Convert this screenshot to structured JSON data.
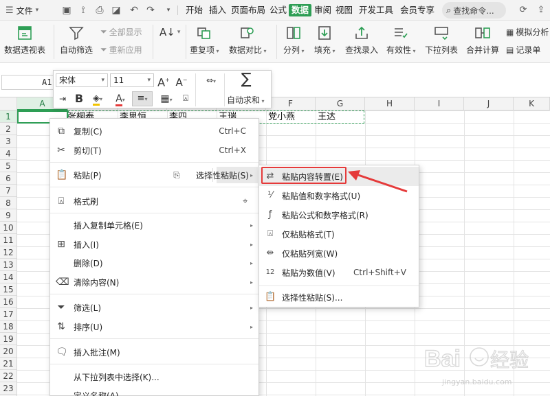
{
  "menubar": {
    "file": "文件",
    "tabs": [
      "开始",
      "插入",
      "页面布局",
      "公式",
      "数据",
      "审阅",
      "视图",
      "开发工具",
      "会员专享"
    ],
    "active_tab": "数据",
    "search_placeholder": "查找命令..."
  },
  "ribbon": {
    "pivot": "数据透视表",
    "autofilter": "自动筛选",
    "show_all": "全部显示",
    "reapply": "重新应用",
    "sort_icon": "AZ-sort-icon",
    "dup": "重复项",
    "compare": "数据对比",
    "split": "分列",
    "fill": "填充",
    "lookup": "查找录入",
    "validity": "有效性",
    "dropdown": "下拉列表",
    "consolidate": "合并计算",
    "simulate": "模拟分析",
    "record": "记录单"
  },
  "namebox": {
    "value": "A1"
  },
  "minibar": {
    "font": "宋体",
    "size": "11",
    "autosum": "自动求和",
    "bold": "B",
    "grow": "A",
    "shrink": "A"
  },
  "columns": [
    "A",
    "B",
    "C",
    "D",
    "E",
    "F",
    "G",
    "H",
    "I",
    "J",
    "K"
  ],
  "rows": [
    "1",
    "2",
    "3",
    "4",
    "5",
    "6",
    "7",
    "8",
    "9",
    "10",
    "11",
    "12",
    "13",
    "14",
    "15",
    "16",
    "17",
    "18",
    "19",
    "20",
    "21",
    "22",
    "23"
  ],
  "cells_row1": [
    "张桐泰",
    "李思恒",
    "李四",
    "王瑞",
    "党小燕",
    "王达"
  ],
  "context_menu": {
    "copy": {
      "label": "复制(C)",
      "key": "Ctrl+C"
    },
    "cut": {
      "label": "剪切(T)",
      "key": "Ctrl+X"
    },
    "paste": {
      "label": "粘贴(P)"
    },
    "paste_special": {
      "label": "选择性粘贴(S)"
    },
    "format_painter": {
      "label": "格式刷"
    },
    "insert_copied": {
      "label": "插入复制单元格(E)"
    },
    "insert": {
      "label": "插入(I)"
    },
    "delete": {
      "label": "删除(D)"
    },
    "clear": {
      "label": "清除内容(N)"
    },
    "filter": {
      "label": "筛选(L)"
    },
    "sort": {
      "label": "排序(U)"
    },
    "comment": {
      "label": "插入批注(M)"
    },
    "pick_list": {
      "label": "从下拉列表中选择(K)..."
    },
    "define_name": {
      "label": "定义名称(A)..."
    }
  },
  "submenu": {
    "transpose": {
      "label": "粘贴内容转置(E)"
    },
    "values_numfmt": {
      "label": "粘贴值和数字格式(U)"
    },
    "formulas_numfmt": {
      "label": "粘贴公式和数字格式(R)"
    },
    "formats_only": {
      "label": "仅粘贴格式(T)"
    },
    "col_widths": {
      "label": "仅粘贴列宽(W)"
    },
    "as_values": {
      "label": "粘贴为数值(V)",
      "key": "Ctrl+Shift+V"
    },
    "paste_special": {
      "label": "选择性粘贴(S)..."
    }
  },
  "watermark": {
    "brand": "Bai",
    "brand2": "经验",
    "url": "jingyan.baidu.com"
  },
  "colors": {
    "accent": "#2e9e55",
    "highlight": "#e53a3a"
  }
}
